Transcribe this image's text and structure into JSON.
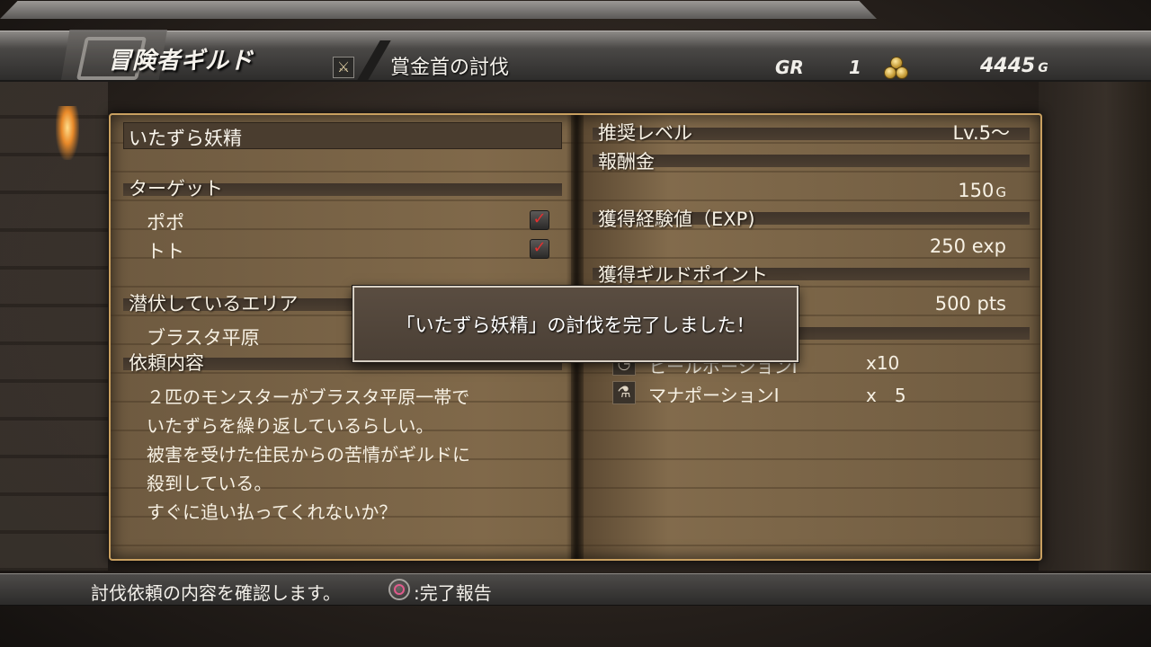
{
  "header": {
    "title": "冒険者ギルド",
    "quest_category": "賞金首の討伐",
    "gr_label": "GR",
    "gr_value": "1",
    "money_value": "4445",
    "money_unit": "G"
  },
  "left_page": {
    "quest_name": "いたずら妖精",
    "target_label": "ターゲット",
    "targets": [
      {
        "name": "ポポ",
        "completed": true
      },
      {
        "name": "トト",
        "completed": true
      }
    ],
    "area_label": "潜伏しているエリア",
    "area_value": "ブラスタ平原",
    "request_label": "依頼内容",
    "request_lines": [
      "２匹のモンスターがブラスタ平原一帯で",
      "いたずらを繰り返しているらしい。",
      "被害を受けた住民からの苦情がギルドに",
      "殺到している。",
      "すぐに追い払ってくれないか？"
    ]
  },
  "right_page": {
    "recommended_level_label": "推奨レベル",
    "recommended_level_value": "Lv.5～",
    "reward_money_label": "報酬金",
    "reward_money_value": "150",
    "reward_money_unit": "G",
    "exp_label": "獲得経験値（EXP)",
    "exp_value": "250",
    "exp_unit": "exp",
    "guild_points_label": "獲得ギルドポイント",
    "guild_points_value": "500",
    "guild_points_unit": "pts",
    "items": [
      {
        "name": "ヒールポーションⅠ",
        "qty": "x10",
        "icon": "potion-icon"
      },
      {
        "name": "マナポーションⅠ",
        "qty": "x　5",
        "icon": "flask-icon"
      }
    ]
  },
  "dialog": {
    "message": "「いたずら妖精」の討伐を完了しました！"
  },
  "footer": {
    "help_text": "討伐依頼の内容を確認します。",
    "action_label": ":完了報告"
  },
  "colors": {
    "check": "#e33030",
    "page_accent": "#c9a060"
  }
}
